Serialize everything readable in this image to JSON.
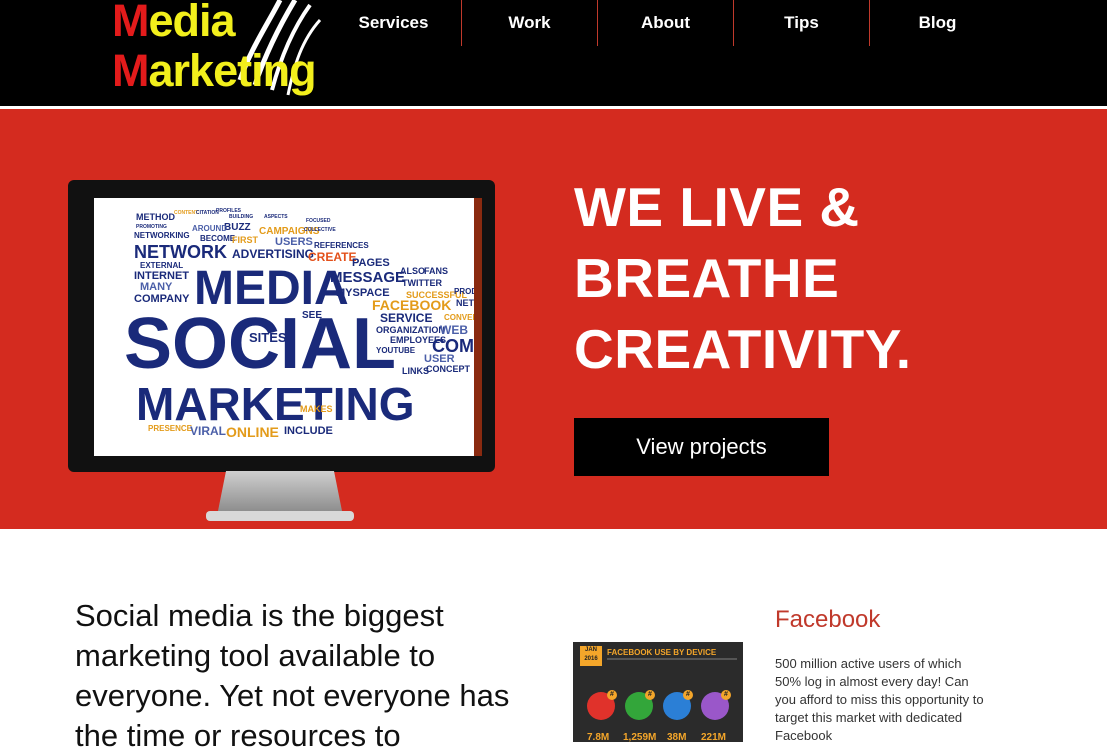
{
  "logo": {
    "line1_first": "M",
    "line1_rest": "edia",
    "line2_first": "M",
    "line2_rest": "arketing"
  },
  "nav": {
    "items": [
      {
        "label": "Services"
      },
      {
        "label": "Work"
      },
      {
        "label": "About"
      },
      {
        "label": "Tips"
      },
      {
        "label": "Blog"
      }
    ]
  },
  "hero": {
    "title_lines": [
      "WE LIVE &",
      "BREATHE",
      "CREATIVITY."
    ],
    "button_label": "View projects"
  },
  "intro": {
    "text": "Social media is the biggest marketing tool available to everyone. Yet not everyone has the time or resources to"
  },
  "infographic": {
    "date": "JAN 2016",
    "title": "FACEBOOK USE BY DEVICE",
    "badge": "#",
    "values": [
      "7.8M",
      "1,259M",
      "38M",
      "221M"
    ]
  },
  "facebook": {
    "title": "Facebook",
    "text": "500 million active users of which 50% log in almost every day! Can you afford to miss this opportunity to target this market with dedicated Facebook"
  },
  "wordcloud": {
    "words": [
      "METHOD",
      "CONTENT",
      "CITATION",
      "PROFILES",
      "BUILDING",
      "ASPECTS",
      "FOCUSED",
      "PROMOTING",
      "BUZZ",
      "CAMPAIGNS",
      "COLLECTIVE",
      "NETWORKING",
      "AROUND",
      "BECOME",
      "FIRST",
      "USERS",
      "REFERENCES",
      "NETWORK",
      "ADVERTISING",
      "CREATE",
      "PAGES",
      "EXTERNAL",
      "INTERNET",
      "MESSAGE",
      "ALSO",
      "FANS",
      "MANY",
      "COMPANY",
      "MEDIA",
      "MYSPACE",
      "TWITTER",
      "FACEBOOK",
      "SUCCESSFUL",
      "SOCIAL",
      "SEE",
      "SERVICE",
      "ORGANIZATION",
      "WEB",
      "COMP",
      "SITES",
      "EMPLOYEES",
      "YOUTUBE",
      "CONCEPT",
      "USER",
      "LINKS",
      "MARKETING",
      "MAKES",
      "PRESENCE",
      "VIRAL",
      "ONLINE",
      "INCLUDE",
      "PROD",
      "CONVER",
      "NETW"
    ]
  },
  "colors": {
    "header_bg": "#000000",
    "hero_bg": "#d42b1f",
    "accent_red": "#e31b1b",
    "accent_yellow": "#f2ef1c",
    "fb_title": "#c0392b"
  }
}
